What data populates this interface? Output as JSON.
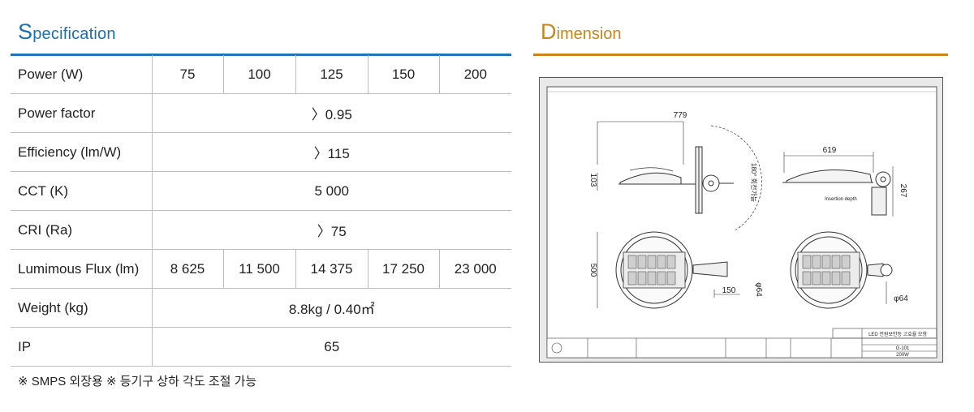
{
  "specification": {
    "title_cap": "S",
    "title_rest": "pecification",
    "rows": [
      {
        "label": "Power (W)",
        "values": [
          "75",
          "100",
          "125",
          "150",
          "200"
        ]
      },
      {
        "label": "Power factor",
        "value": "〉0.95"
      },
      {
        "label": "Efficiency (lm/W)",
        "value": "〉115"
      },
      {
        "label": "CCT (K)",
        "value": "5 000"
      },
      {
        "label": "CRI (Ra)",
        "value": "〉75"
      },
      {
        "label": "Lumimous Flux (lm)",
        "values": [
          "8 625",
          "11 500",
          "14 375",
          "17 250",
          "23 000"
        ]
      },
      {
        "label": "Weight (kg)",
        "value": "8.8kg / 0.40㎡"
      },
      {
        "label": "IP",
        "value": "65"
      }
    ],
    "note": "※ SMPS 외장용 ※ 등기구 상하 각도 조절 가능"
  },
  "dimension": {
    "title_cap": "D",
    "title_rest": "imension",
    "labels": {
      "width_side": "779",
      "height_side": "103",
      "rotation": "180° 회전가능",
      "width_side2": "619",
      "height_side2": "267",
      "insertion": "Insertion depth",
      "diameter": "500",
      "arm": "150",
      "pipe1": "φ64",
      "pipe2": "φ64"
    },
    "title_block": {
      "drawing_name": "LED 전원보안등 고효율 모형",
      "model": "G-101",
      "power": "200W"
    }
  },
  "colors": {
    "spec_accent": "#1e74ba",
    "dim_accent": "#c98519"
  }
}
